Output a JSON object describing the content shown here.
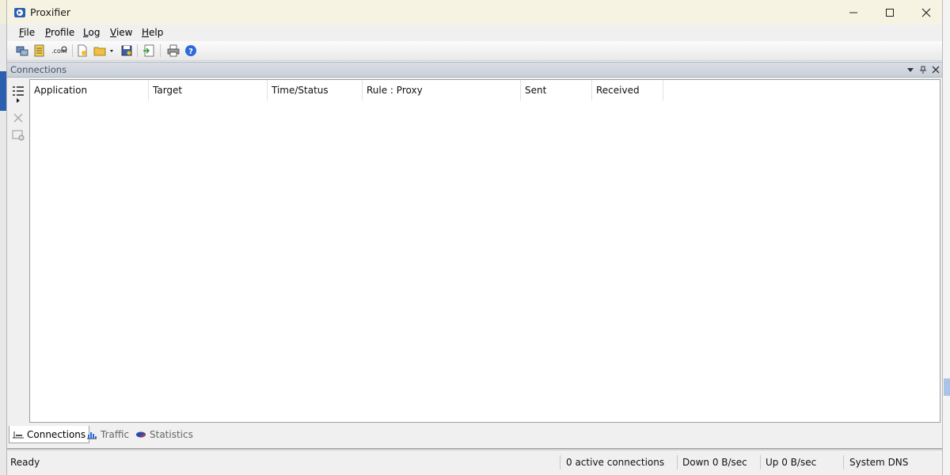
{
  "window": {
    "title": "Proxifier"
  },
  "menu": {
    "items": [
      {
        "key": "F",
        "rest": "ile"
      },
      {
        "key": "P",
        "rest": "rofile"
      },
      {
        "key": "L",
        "rest": "og"
      },
      {
        "key": "V",
        "rest": "iew"
      },
      {
        "key": "H",
        "rest": "elp"
      }
    ]
  },
  "toolbar": {
    "icons": [
      "proxy-servers-icon",
      "proxification-rules-icon",
      "name-resolution-icon",
      "new-profile-icon",
      "open-profile-icon",
      "save-profile-icon",
      "import-icon",
      "print-icon",
      "help-icon"
    ]
  },
  "panel": {
    "title": "Connections"
  },
  "table": {
    "columns": [
      "Application",
      "Target",
      "Time/Status",
      "Rule : Proxy",
      "Sent",
      "Received"
    ],
    "rows": []
  },
  "tabs": [
    {
      "label": "Connections",
      "active": true
    },
    {
      "label": "Traffic",
      "active": false
    },
    {
      "label": "Statistics",
      "active": false
    }
  ],
  "status": {
    "ready": "Ready",
    "active_connections": "0 active connections",
    "down": "Down 0 B/sec",
    "up": "Up 0 B/sec",
    "dns": "System DNS"
  },
  "colors": {
    "accent": "#2d5fb0",
    "title_bar": "#f7f3e3",
    "panel_header": "#cfd5de"
  }
}
